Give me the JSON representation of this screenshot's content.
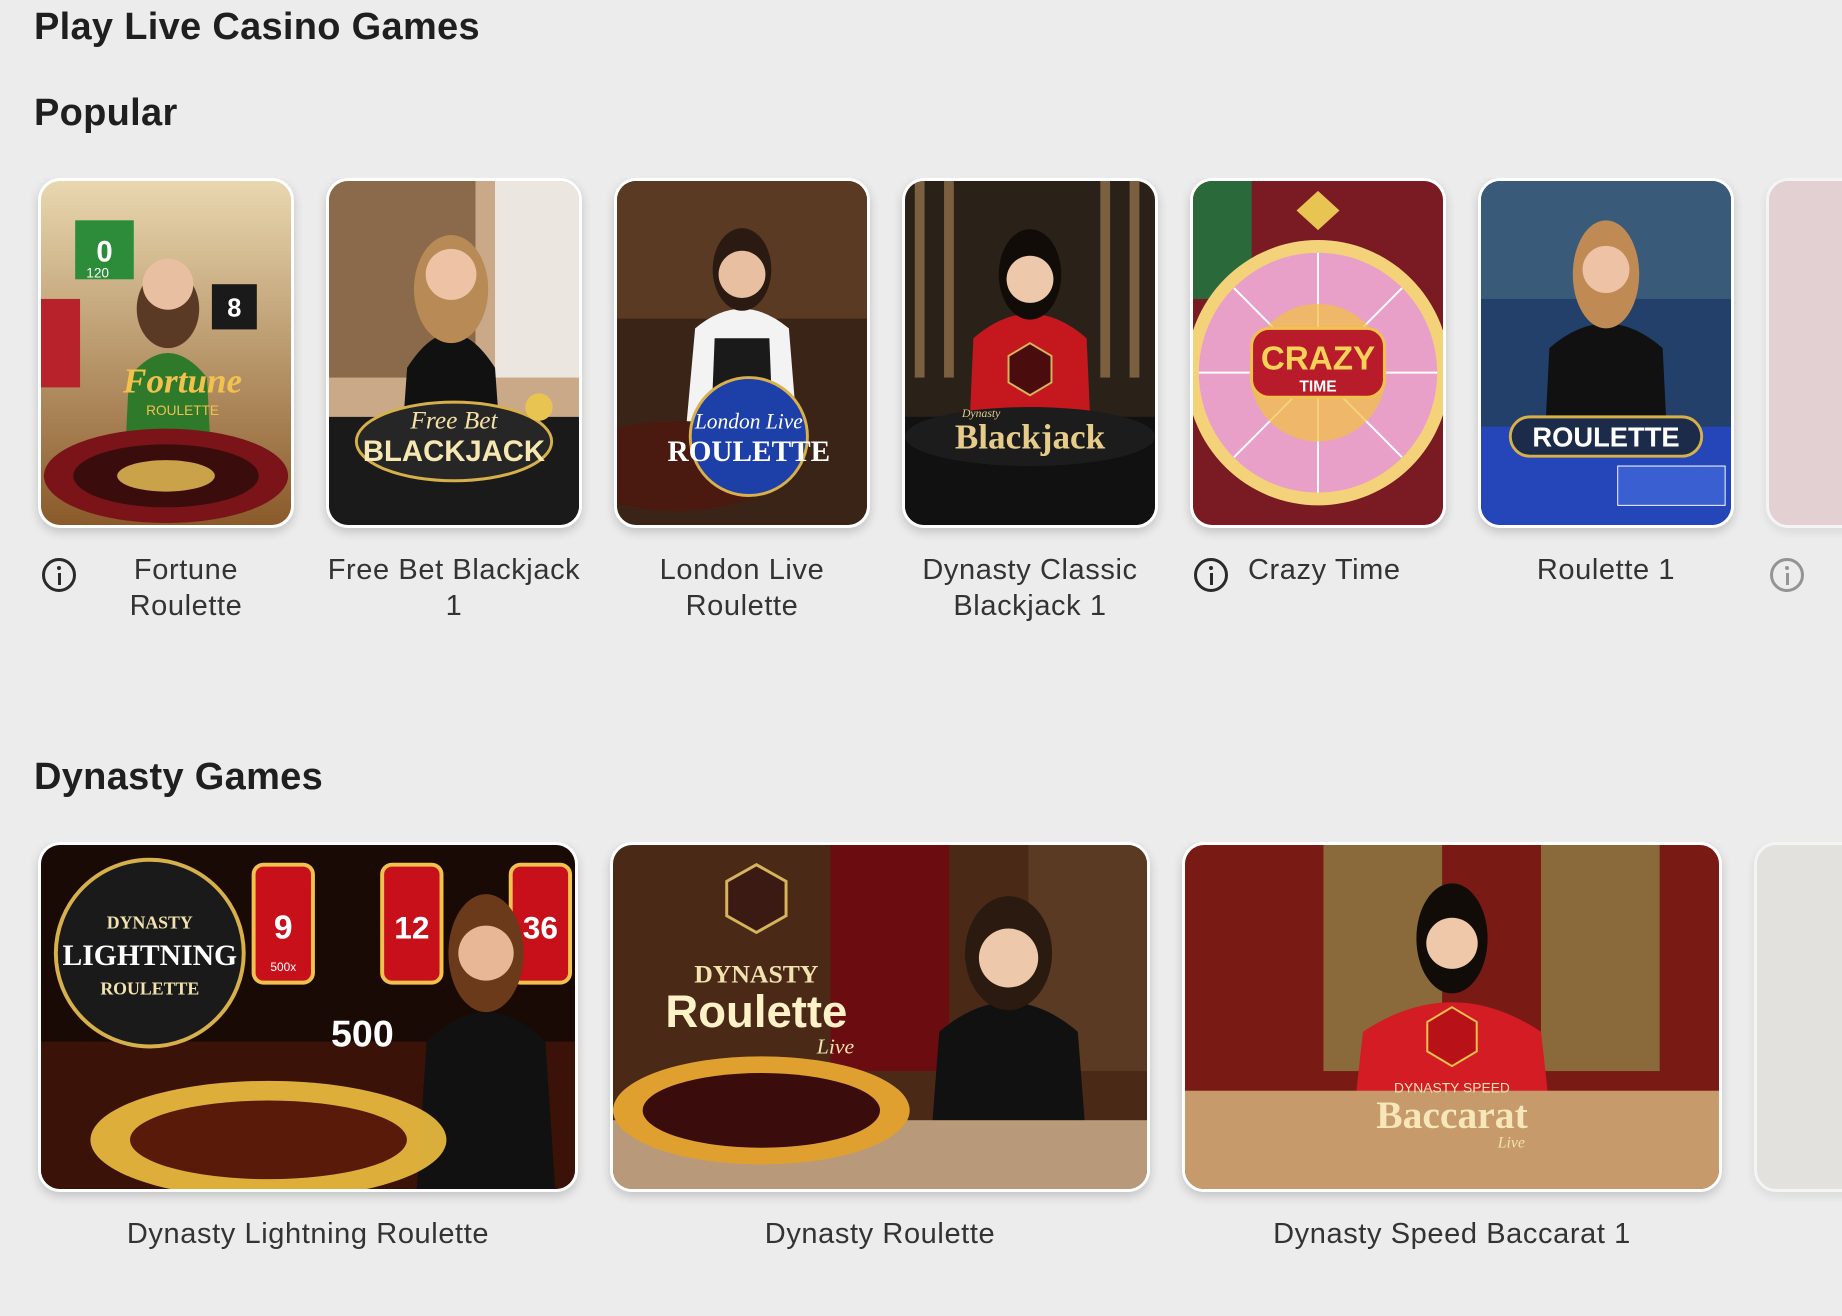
{
  "page": {
    "title": "Play Live Casino Games"
  },
  "sections": [
    {
      "title": "Popular",
      "games": [
        {
          "title": "Fortune Roulette",
          "has_info": true,
          "logo_text": "Fortune",
          "logo_sub": "ROULETTE",
          "accent": "#b8232b"
        },
        {
          "title": "Free Bet Blackjack 1",
          "has_info": false,
          "logo_text": "BLACKJACK",
          "logo_sub": "Free Bet",
          "accent": "#d9b24a"
        },
        {
          "title": "London Live Roulette",
          "has_info": false,
          "logo_text": "ROULETTE",
          "logo_sub": "London Live",
          "accent": "#2a4fb8"
        },
        {
          "title": "Dynasty Classic Blackjack 1",
          "has_info": false,
          "logo_text": "Blackjack",
          "logo_sub": "Dynasty",
          "accent": "#d6b45c"
        },
        {
          "title": "Crazy Time",
          "has_info": true,
          "logo_text": "CRAZY",
          "logo_sub": "TIME",
          "accent": "#d03a2c"
        },
        {
          "title": "Roulette 1",
          "has_info": false,
          "logo_text": "ROULETTE",
          "logo_sub": "",
          "accent": "#1d3fa8"
        }
      ]
    },
    {
      "title": "Dynasty Games",
      "games": [
        {
          "title": "Dynasty Lightning Roulette",
          "logo_text": "LIGHTNING",
          "logo_sub": "DYNASTY",
          "logo_sub2": "ROULETTE",
          "badge_numbers": [
            "9",
            "12",
            "36"
          ],
          "multiplier": "500",
          "multiplier_small": "500x"
        },
        {
          "title": "Dynasty Roulette",
          "logo_text": "Roulette",
          "logo_sub": "DYNASTY",
          "logo_sub2": "Live"
        },
        {
          "title": "Dynasty Speed Baccarat 1",
          "logo_text": "Baccarat",
          "logo_sub": "DYNASTY SPEED",
          "logo_sub2": "Live"
        }
      ]
    }
  ],
  "thumb_numbers": {
    "fortune_a": "0",
    "fortune_b": "120",
    "fortune_c": "8"
  },
  "colors": {
    "background": "#ececec",
    "text": "#1f1f1f",
    "caption": "#333333"
  }
}
